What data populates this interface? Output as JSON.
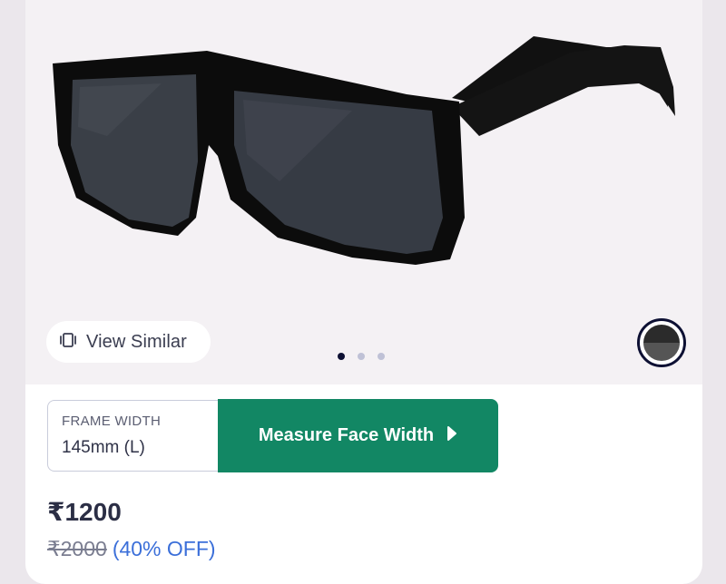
{
  "product": {
    "image_alt": "Black square sunglasses",
    "view_similar_label": "View Similar",
    "view_similar_icon": "stacked-cards-icon",
    "carousel": {
      "count": 3,
      "active_index": 0
    },
    "selected_color": "#3a3a3a"
  },
  "frame": {
    "label": "FRAME WIDTH",
    "value": "145mm (L)"
  },
  "measure_button": {
    "label": "Measure Face Width",
    "icon": "play-triangle-icon"
  },
  "pricing": {
    "price": "₹1200",
    "original_price": "₹2000",
    "discount": "(40% OFF)"
  },
  "colors": {
    "accent_green": "#128764",
    "discount_blue": "#3b6fd9",
    "dark_navy": "#0d1033",
    "image_bg": "#f4f1f4"
  }
}
